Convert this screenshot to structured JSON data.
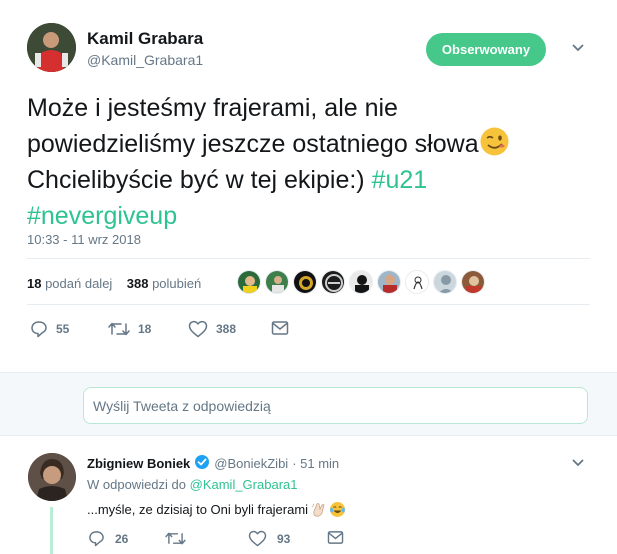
{
  "tweet": {
    "author_name": "Kamil Grabara",
    "author_handle": "@Kamil_Grabara1",
    "follow_label": "Obserwowany",
    "text_line1": "Może i jesteśmy frajerami, ale nie",
    "text_line2": "powiedzieliśmy jeszcze ostatniego słowa",
    "text_line3": "Chcielibyście być w tej ekipie:) ",
    "hashtag1": "#u21",
    "hashtag2": "#nevergiveup",
    "timestamp": "10:33 - 11 wrz 2018",
    "retweets_count": "18",
    "retweets_label": " podań dalej",
    "likes_count": "388",
    "likes_label": " polubień",
    "actions": {
      "replies": "55",
      "retweets": "18",
      "likes": "388"
    },
    "emoji": "winking-face-icon"
  },
  "reply_box": {
    "placeholder": "Wyślij Tweeta z odpowiedzią"
  },
  "reply": {
    "author_name": "Zbigniew Boniek",
    "author_handle": "@BoniekZibi",
    "time": "· 51 min",
    "context_prefix": "W odpowiedzi do ",
    "context_mention": "@Kamil_Grabara1",
    "text": "...myśle, ze dzisiaj to Oni byli frajerami",
    "actions": {
      "replies": "26",
      "likes": "93"
    }
  },
  "colors": {
    "accent": "#2fc292",
    "follow_button": "#46c88a",
    "muted": "#657786"
  }
}
